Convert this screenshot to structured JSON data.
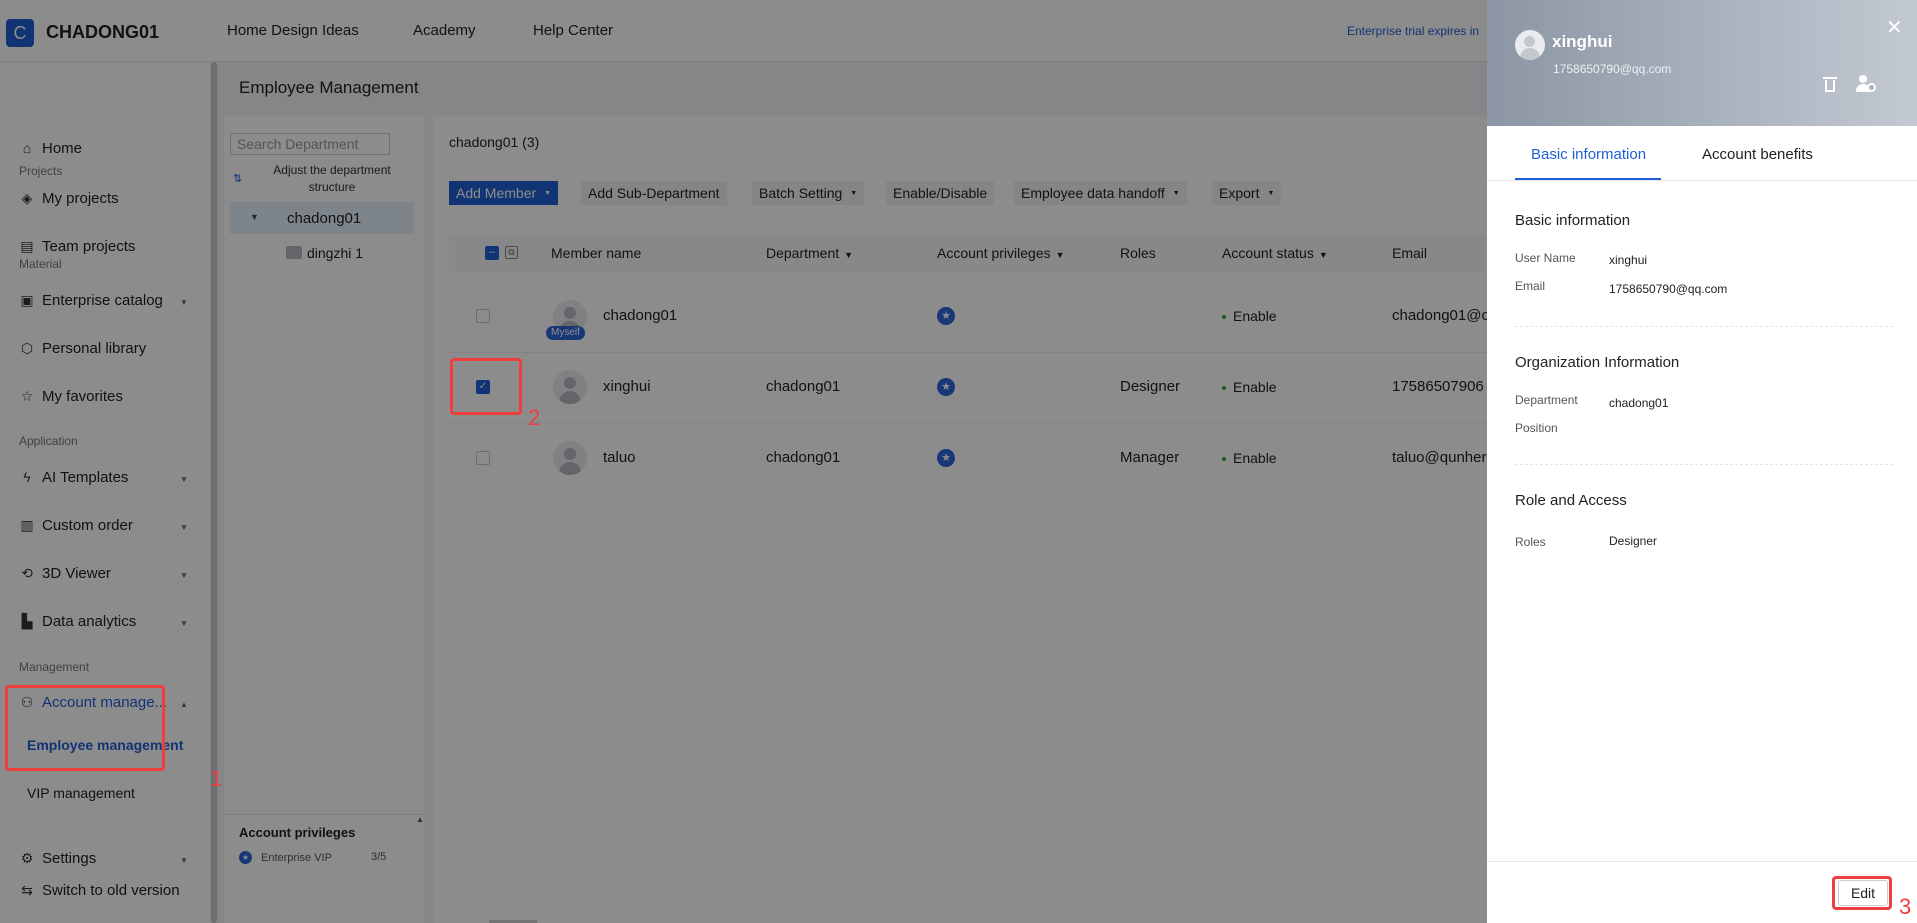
{
  "brand": {
    "logo_letter": "C",
    "name": "CHADONG01"
  },
  "topnav": [
    "Home Design Ideas",
    "Academy",
    "Help Center"
  ],
  "trial_notice": "Enterprise trial expires in",
  "sidebar": {
    "home": "Home",
    "sections": {
      "projects": "Projects",
      "material": "Material",
      "application": "Application",
      "management": "Management"
    },
    "items": {
      "my_projects": "My projects",
      "team_projects": "Team projects",
      "enterprise_catalog": "Enterprise catalog",
      "personal_library": "Personal library",
      "my_favorites": "My favorites",
      "ai_templates": "AI Templates",
      "custom_order": "Custom order",
      "viewer_3d": "3D Viewer",
      "data_analytics": "Data analytics",
      "account_management": "Account manage...",
      "employee_management": "Employee management",
      "vip_management": "VIP management",
      "settings": "Settings",
      "switch_old": "Switch to old version"
    }
  },
  "page": {
    "title": "Employee Management"
  },
  "departments": {
    "search_placeholder": "Search Department",
    "adjust_label": "Adjust the department structure",
    "root": "chadong01",
    "child": "dingzhi 1"
  },
  "privileges_box": {
    "title": "Account privileges",
    "item": "Enterprise VIP",
    "count": "3/5"
  },
  "content": {
    "title": "chadong01 (3)",
    "toolbar": {
      "add_member": "Add Member",
      "add_sub_department": "Add Sub-Department",
      "batch_setting": "Batch Setting",
      "enable_disable": "Enable/Disable",
      "employee_data_handoff": "Employee data handoff",
      "export": "Export"
    },
    "columns": {
      "member_name": "Member name",
      "department": "Department",
      "account_privileges": "Account privileges",
      "roles": "Roles",
      "account_status": "Account status",
      "email": "Email"
    },
    "rows": [
      {
        "name": "chadong01",
        "tag": "Myself",
        "department": "",
        "role": "",
        "status": "Enable",
        "email": "chadong01@c",
        "checked": false
      },
      {
        "name": "xinghui",
        "tag": "",
        "department": "chadong01",
        "role": "Designer",
        "status": "Enable",
        "email": "17586507906",
        "checked": true
      },
      {
        "name": "taluo",
        "tag": "",
        "department": "chadong01",
        "role": "Manager",
        "status": "Enable",
        "email": "taluo@qunher",
        "checked": false
      }
    ]
  },
  "drawer": {
    "name": "xinghui",
    "email": "1758650790@qq.com",
    "tabs": [
      "Basic information",
      "Account benefits"
    ],
    "basic": {
      "title": "Basic information",
      "user_name_label": "User Name",
      "user_name": "xinghui",
      "email_label": "Email",
      "email": "1758650790@qq.com"
    },
    "org": {
      "title": "Organization Information",
      "department_label": "Department",
      "department": "chadong01",
      "position_label": "Position",
      "position": ""
    },
    "role": {
      "title": "Role and Access",
      "roles_label": "Roles",
      "roles": "Designer"
    },
    "edit_label": "Edit"
  },
  "annotations": [
    "1",
    "2",
    "3"
  ],
  "colors": {
    "accent": "#1f5fd6",
    "annotation": "#ef3e3e",
    "status_enable": "#37a24d"
  }
}
